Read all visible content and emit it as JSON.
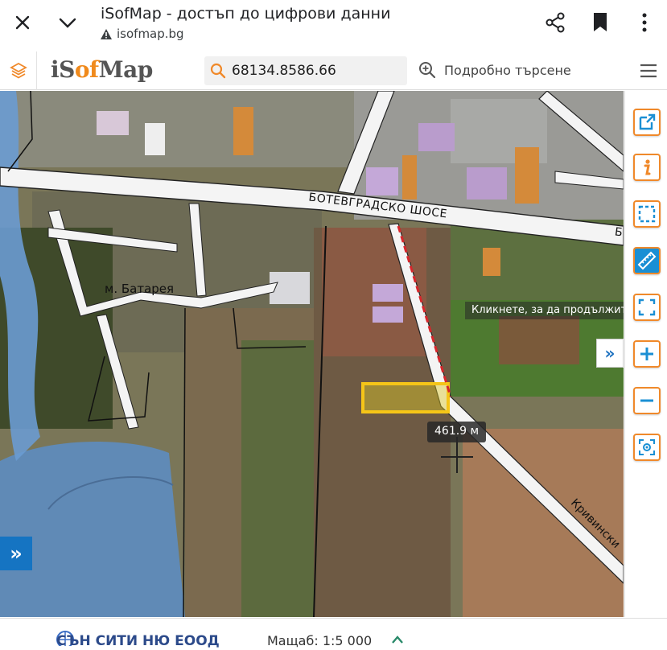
{
  "browser": {
    "title": "iSofMap - достъп до цифрови данни",
    "url": "isofmap.bg"
  },
  "app": {
    "logo_prefix": "iS",
    "logo_accent": "of",
    "logo_suffix": "Map",
    "search_value": "68134.8586.66",
    "advanced_search": "Подробно търсене",
    "accent_color": "#f0892a"
  },
  "map": {
    "street_1": "БОТЕВГРАДСКО ШОСЕ",
    "street_1_cut": "Б",
    "street_2": "Кривински",
    "locality": "м. Батарея",
    "tooltip": "Кликнете, за да продължите",
    "measurement": "461.9 м"
  },
  "footer": {
    "company": "СЪН СИТИ НЮ ЕООД",
    "scale_label": "Мащаб:",
    "scale_value": "1:5 000"
  },
  "tools": [
    "external-link-icon",
    "info-icon",
    "select-area-icon",
    "ruler-icon",
    "full-extent-icon",
    "zoom-in-icon",
    "zoom-out-icon",
    "locate-icon"
  ]
}
